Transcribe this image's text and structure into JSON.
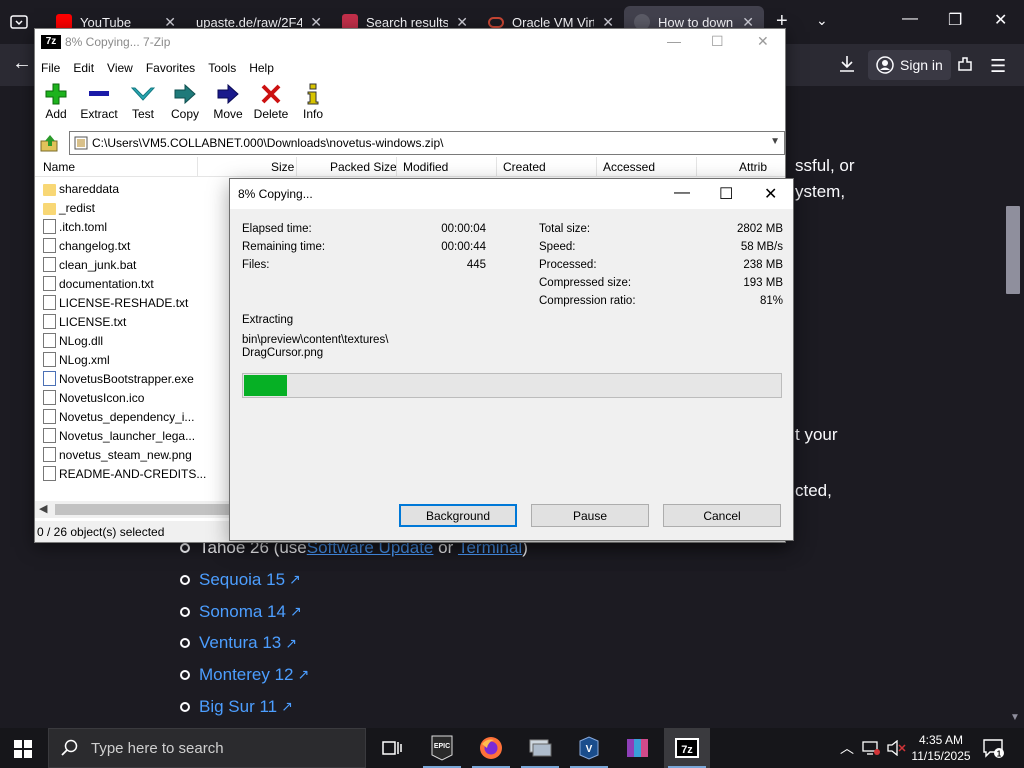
{
  "browser": {
    "tabs": [
      {
        "label": "YouTube",
        "color": "#ff0000"
      },
      {
        "label": "upaste.de/raw/2F4",
        "color": ""
      },
      {
        "label": "Search results fo",
        "color": "#c22f4a"
      },
      {
        "label": "Oracle VM Virtu",
        "color": "#c74634"
      },
      {
        "label": "How to downlo",
        "color": ""
      }
    ],
    "signin_label": "Sign in",
    "page": {
      "frag_1": "ssful, or",
      "frag_2": "ystem,",
      "frag_3": "t your",
      "frag_4": "cted,",
      "tahoe": {
        "prefix": "Tahoe 26 (use ",
        "link1": "Software Update",
        "mid": " or ",
        "link2": "Terminal",
        "suffix": ")"
      },
      "links": [
        "Sequoia 15",
        "Sonoma 14",
        "Ventura 13",
        "Monterey 12",
        "Big Sur 11"
      ]
    }
  },
  "zip": {
    "title": "8% Copying... 7-Zip",
    "logo": "7z",
    "menu": [
      "File",
      "Edit",
      "View",
      "Favorites",
      "Tools",
      "Help"
    ],
    "toolbar": [
      {
        "label": "Add",
        "icon": "plus-icon",
        "color": "#1db31d"
      },
      {
        "label": "Extract",
        "icon": "minus-icon",
        "color": "#1a1aa8"
      },
      {
        "label": "Test",
        "icon": "check-arrow-icon",
        "color": "#29a8b4"
      },
      {
        "label": "Copy",
        "icon": "copy-arrow-icon",
        "color": "#1f7a7a"
      },
      {
        "label": "Move",
        "icon": "move-arrow-icon",
        "color": "#1a1a8c"
      },
      {
        "label": "Delete",
        "icon": "delete-x-icon",
        "color": "#cc1111"
      },
      {
        "label": "Info",
        "icon": "info-icon",
        "color": "#d8c400"
      }
    ],
    "path": "C:\\Users\\VM5.COLLABNET.000\\Downloads\\novetus-windows.zip\\",
    "columns": [
      "Name",
      "Size",
      "Packed Size",
      "Modified",
      "Created",
      "Accessed",
      "Attrib"
    ],
    "files": [
      {
        "name": "shareddata",
        "type": "folder"
      },
      {
        "name": "_redist",
        "type": "folder"
      },
      {
        "name": ".itch.toml",
        "type": "doc"
      },
      {
        "name": "changelog.txt",
        "type": "doc"
      },
      {
        "name": "clean_junk.bat",
        "type": "bat"
      },
      {
        "name": "documentation.txt",
        "type": "doc"
      },
      {
        "name": "LICENSE-RESHADE.txt",
        "type": "doc"
      },
      {
        "name": "LICENSE.txt",
        "type": "doc"
      },
      {
        "name": "NLog.dll",
        "type": "doc"
      },
      {
        "name": "NLog.xml",
        "type": "doc"
      },
      {
        "name": "NovetusBootstrapper.exe",
        "type": "exe"
      },
      {
        "name": "NovetusIcon.ico",
        "type": "doc"
      },
      {
        "name": "Novetus_dependency_i...",
        "type": "bat"
      },
      {
        "name": "Novetus_launcher_lega...",
        "type": "bat"
      },
      {
        "name": "novetus_steam_new.png",
        "type": "doc"
      },
      {
        "name": "README-AND-CREDITS...",
        "type": "doc"
      }
    ],
    "status": "0 / 26 object(s) selected"
  },
  "dialog": {
    "title": "8% Copying...",
    "left_stats": [
      {
        "label": "Elapsed time:",
        "value": "00:00:04"
      },
      {
        "label": "Remaining time:",
        "value": "00:00:44"
      },
      {
        "label": "Files:",
        "value": "445"
      }
    ],
    "right_stats": [
      {
        "label": "Total size:",
        "value": "2802 MB"
      },
      {
        "label": "Speed:",
        "value": "58 MB/s"
      },
      {
        "label": "Processed:",
        "value": "238 MB"
      },
      {
        "label": "Compressed size:",
        "value": "193 MB"
      },
      {
        "label": "Compression ratio:",
        "value": "81%"
      }
    ],
    "action": "Extracting",
    "current_path": "bin\\preview\\content\\textures\\",
    "current_file": "DragCursor.png",
    "progress_fraction": 0.08,
    "progress_color": "#06b025",
    "buttons": {
      "background": "Background",
      "pause": "Pause",
      "cancel": "Cancel"
    }
  },
  "taskbar": {
    "search_placeholder": "Type here to search",
    "time": "4:35 AM",
    "date": "11/15/2025",
    "apps": [
      "task-view-icon",
      "epic-games-icon",
      "firefox-icon",
      "network-app-icon",
      "virtualbox-icon",
      "winrar-icon",
      "7zip-icon"
    ]
  }
}
